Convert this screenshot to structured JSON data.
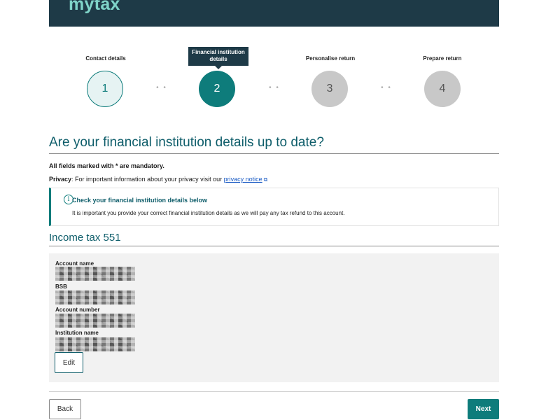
{
  "header": {
    "logo_text": "mytax"
  },
  "steps": [
    {
      "label": "Contact details",
      "number": "1",
      "state": "done"
    },
    {
      "label": "Financial institution details",
      "number": "2",
      "state": "active"
    },
    {
      "label": "Personalise return",
      "number": "3",
      "state": "future"
    },
    {
      "label": "Prepare return",
      "number": "4",
      "state": "future"
    }
  ],
  "step_separator": "• •",
  "page_title": "Are your financial institution details up to date?",
  "mandatory_note": "All fields marked with * are mandatory.",
  "privacy": {
    "label": "Privacy",
    "text": ": For important information about your privacy visit our ",
    "link": "privacy notice"
  },
  "alert": {
    "title": "Check your financial institution details below",
    "body": "It is important you provide your correct financial institution details as we will pay any tax refund to this account."
  },
  "section_title": "Income tax 551",
  "fields": [
    {
      "label": "Account name"
    },
    {
      "label": "BSB"
    },
    {
      "label": "Account number"
    },
    {
      "label": "Institution name"
    }
  ],
  "buttons": {
    "edit": "Edit",
    "back": "Back",
    "next": "Next"
  },
  "colors": {
    "teal": "#0e7c7b",
    "navy": "#1e3a47",
    "link": "#1a5bc4"
  }
}
